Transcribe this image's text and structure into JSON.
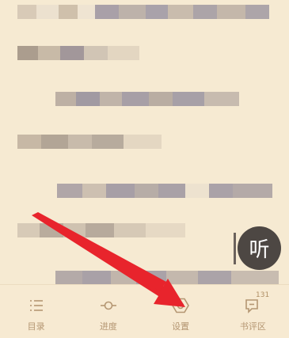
{
  "reader": {
    "listen_label": "听"
  },
  "bottom_bar": {
    "items": [
      {
        "label": "目录",
        "icon": "toc-list-icon"
      },
      {
        "label": "进度",
        "icon": "progress-slider-icon"
      },
      {
        "label": "设置",
        "icon": "settings-hex-icon"
      },
      {
        "label": "书评区",
        "icon": "comment-icon",
        "badge": "131"
      }
    ]
  },
  "colors": {
    "background": "#f6ead2",
    "accent_text": "#b49672",
    "arrow": "#e8242c",
    "listen_button": "#4d4743"
  }
}
